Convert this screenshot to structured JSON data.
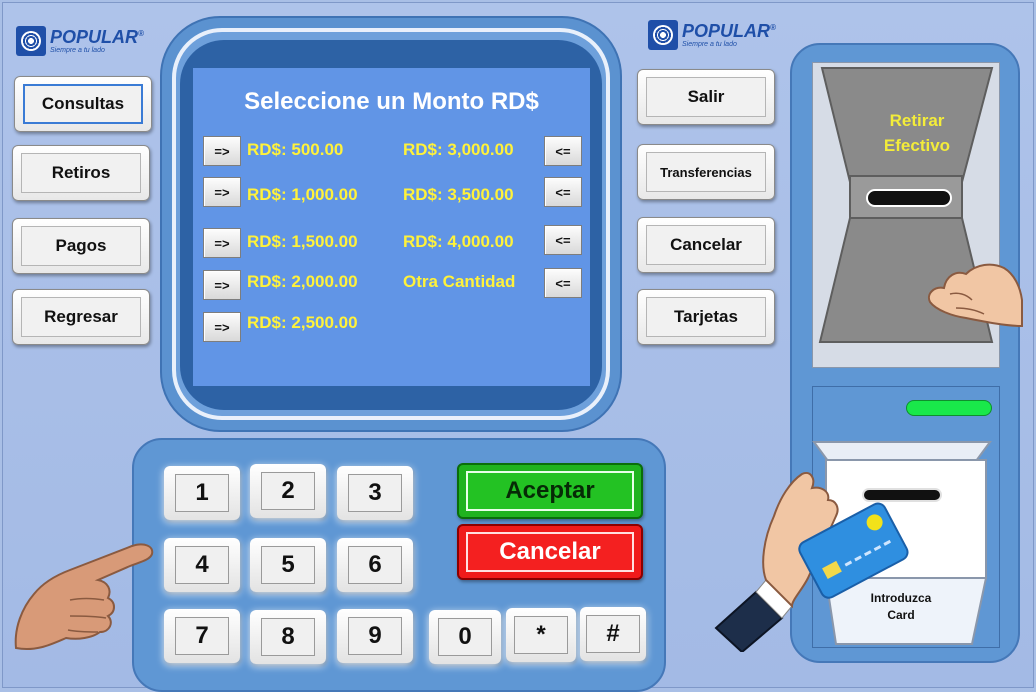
{
  "brand": {
    "name": "POPULAR",
    "tagline": "Siempre a tu lado",
    "registered": "®"
  },
  "left_menu": [
    {
      "label": "Consultas",
      "selected": true
    },
    {
      "label": "Retiros"
    },
    {
      "label": "Pagos"
    },
    {
      "label": "Regresar"
    }
  ],
  "right_menu": [
    {
      "label": "Salir"
    },
    {
      "label": "Transferencias"
    },
    {
      "label": "Cancelar"
    },
    {
      "label": "Tarjetas"
    }
  ],
  "screen": {
    "title": "Seleccione un Monto RD$",
    "left_arrow": "=>",
    "right_arrow": "<=",
    "left_amounts": [
      "RD$: 500.00",
      "RD$: 1,000.00",
      "RD$: 1,500.00",
      "RD$: 2,000.00",
      "RD$: 2,500.00"
    ],
    "right_amounts": [
      "RD$: 3,000.00",
      "RD$: 3,500.00",
      "RD$: 4,000.00",
      "Otra Cantidad"
    ]
  },
  "keypad": {
    "keys": [
      "1",
      "2",
      "3",
      "4",
      "5",
      "6",
      "7",
      "8",
      "9",
      "0",
      "*",
      "#"
    ],
    "accept": "Aceptar",
    "cancel": "Cancelar"
  },
  "dispenser": {
    "line1": "Retirar",
    "line2": "Efectivo"
  },
  "card_reader": {
    "line1": "Introduzca",
    "line2": "Card"
  },
  "colors": {
    "screen": "#6195e6",
    "amount_text": "#fff23a",
    "accept": "#1fb31f",
    "cancel": "#f01a1a",
    "led": "#19e84a"
  }
}
